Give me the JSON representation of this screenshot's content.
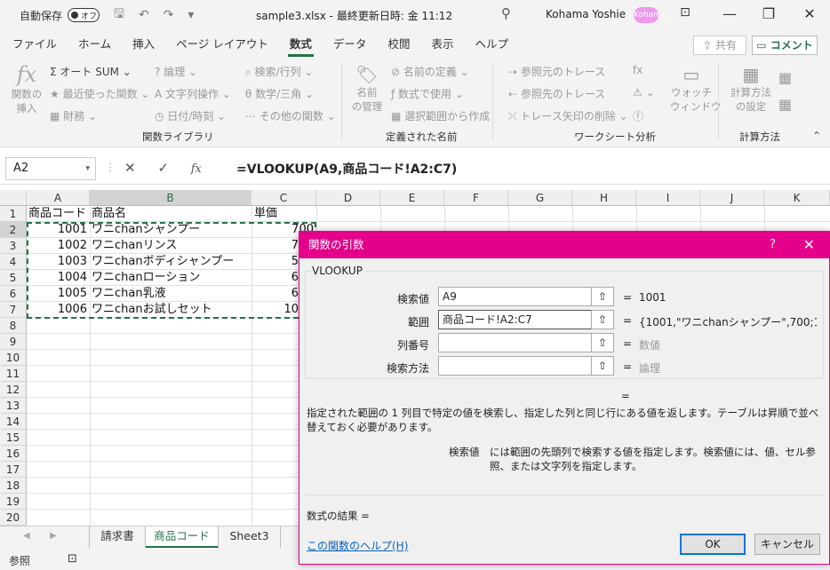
{
  "titlebar": {
    "autosave": "自動保存",
    "toggle": "オフ",
    "doc": "sample3.xlsx - 最終更新日時: 金 11:12",
    "search_icon": "search-icon",
    "user": "Kohama Yoshie",
    "avatar": "Kohama",
    "minimize": "—",
    "restore": "❐",
    "close": "✕"
  },
  "menu": {
    "tabs": [
      "ファイル",
      "ホーム",
      "挿入",
      "ページ レイアウト",
      "数式",
      "データ",
      "校閲",
      "表示",
      "ヘルプ"
    ],
    "active": "数式",
    "share": "共有",
    "comment": "コメント"
  },
  "ribbon": {
    "insert_fn_line1": "関数の",
    "insert_fn_line2": "挿入",
    "autosum": "オート SUM",
    "recent": "最近使った関数",
    "finance": "財務",
    "logical": "論理",
    "text": "文字列操作",
    "datetime": "日付/時刻",
    "lookup": "検索/行列",
    "math": "数学/三角",
    "other": "その他の関数",
    "group1": "関数ライブラリ",
    "name_mgr_line1": "名前",
    "name_mgr_line2": "の管理",
    "define_name": "名前の定義",
    "use_in_formula": "数式で使用",
    "create_from_sel": "選択範囲から作成",
    "group2": "定義された名前",
    "trace_prec": "参照元のトレース",
    "trace_dep": "参照先のトレース",
    "remove_arrows": "トレース矢印の削除",
    "watch_line1": "ウォッチ",
    "watch_line2": "ウィンドウ",
    "group3": "ワークシート分析",
    "calc_opt_line1": "計算方法",
    "calc_opt_line2": "の設定",
    "group4": "計算方法"
  },
  "formulabar": {
    "namebox": "A2",
    "formula": "=VLOOKUP(A9,商品コード!A2:C7)",
    "fx": "fx"
  },
  "columns": [
    "A",
    "B",
    "C",
    "D",
    "E",
    "F",
    "G",
    "H",
    "I",
    "J",
    "K"
  ],
  "rows": [
    "1",
    "2",
    "3",
    "4",
    "5",
    "6",
    "7",
    "8",
    "9",
    "10",
    "11",
    "12",
    "13",
    "14",
    "15",
    "16",
    "17",
    "18",
    "19",
    "20"
  ],
  "cells": {
    "header": [
      "商品コード",
      "商品名",
      "単価"
    ],
    "data": [
      [
        "1001",
        "ワニchanシャンプー",
        "700"
      ],
      [
        "1002",
        "ワニchanリンス",
        "7"
      ],
      [
        "1003",
        "ワニchanボディシャンプー",
        "5"
      ],
      [
        "1004",
        "ワニchanローション",
        "6"
      ],
      [
        "1005",
        "ワニchan乳液",
        "6"
      ],
      [
        "1006",
        "ワニchanお試しセット",
        "10"
      ]
    ]
  },
  "sheets": {
    "tabs": [
      "請求書",
      "商品コード",
      "Sheet3"
    ],
    "active": "商品コード"
  },
  "status": {
    "mode": "参照"
  },
  "dialog": {
    "title": "関数の引数",
    "help": "?",
    "close": "✕",
    "function": "VLOOKUP",
    "args": [
      {
        "label": "検索値",
        "value": "A9",
        "result": "1001"
      },
      {
        "label": "範囲",
        "value": "商品コード!A2:C7",
        "result": "{1001,\"ワニchanシャンプー\",700;10..."
      },
      {
        "label": "列番号",
        "value": "",
        "result": "数値"
      },
      {
        "label": "検索方法",
        "value": "",
        "result": "論理"
      }
    ],
    "eq": "=",
    "description": "指定された範囲の 1 列目で特定の値を検索し、指定した列と同じ行にある値を返します。テーブルは昇順で並べ替えておく必要があります。",
    "arg_name": "検索値",
    "arg_desc": "には範囲の先頭列で検索する値を指定します。検索値には、値、セル参照、または文字列を指定します。",
    "result_label": "数式の結果 =",
    "help_link": "この関数のヘルプ(H)",
    "ok": "OK",
    "cancel": "キャンセル"
  }
}
